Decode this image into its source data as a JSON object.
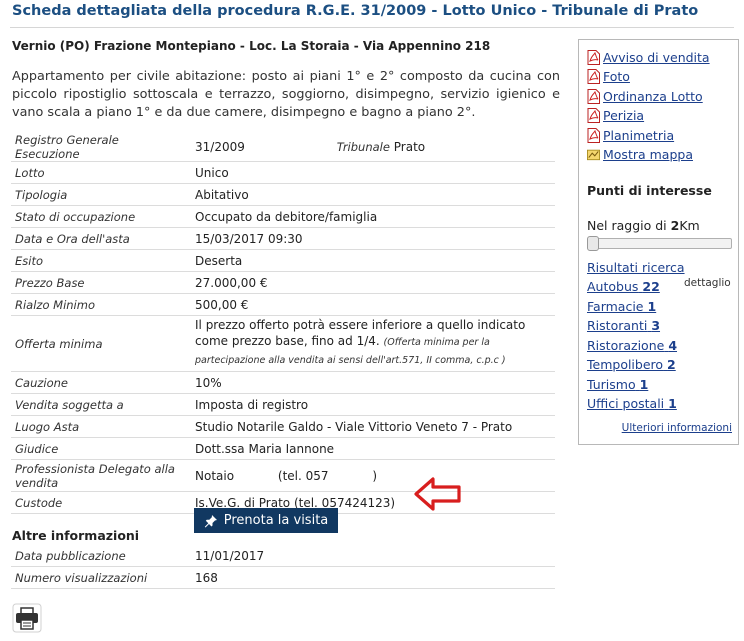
{
  "header": {
    "title": "Scheda dettagliata della procedura R.G.E. 31/2009 - Lotto Unico - Tribunale di Prato",
    "address": "Vernio (PO) Frazione Montepiano - Loc. La Storaia - Via Appennino 218",
    "description": "Appartamento per civile abitazione: posto ai piani 1° e 2° composto da cucina con piccolo ripostiglio sottoscala e terrazzo, soggiorno, disimpegno, servizio igienico e vano scala a piano 1° e da due camere, disimpegno e bagno a piano 2°."
  },
  "details": {
    "registro_label": "Registro Generale Esecuzione",
    "registro_value": "31/2009",
    "tribunale_label": "Tribunale",
    "tribunale_value": "Prato",
    "rows": [
      {
        "label": "Lotto",
        "value": "Unico"
      },
      {
        "label": "Tipologia",
        "value": "Abitativo"
      },
      {
        "label": "Stato di occupazione",
        "value": "Occupato da debitore/famiglia"
      },
      {
        "label": "Data e Ora dell'asta",
        "value": "15/03/2017 09:30"
      },
      {
        "label": "Esito",
        "value": "Deserta"
      },
      {
        "label": "Prezzo Base",
        "value": "27.000,00 €"
      },
      {
        "label": "Rialzo Minimo",
        "value": "500,00 €"
      }
    ],
    "offerta_label": "Offerta minima",
    "offerta_value": "Il prezzo offerto potrà essere inferiore a quello indicato come prezzo base, fino ad 1/4.",
    "offerta_note": "(Offerta minima per la partecipazione alla vendita ai sensi dell'art.571, II comma, c.p.c )",
    "rows2": [
      {
        "label": "Cauzione",
        "value": "10%"
      },
      {
        "label": "Vendita soggetta a",
        "value": "Imposta di registro"
      },
      {
        "label": "Luogo Asta",
        "value": "Studio Notarile Galdo - Viale Vittorio Veneto 7 - Prato"
      },
      {
        "label": "Giudice",
        "value": "Dott.ssa Maria Iannone"
      }
    ],
    "professionista_label": "Professionista Delegato alla vendita",
    "professionista_value": "Notaio",
    "professionista_phone": "(tel. 057",
    "professionista_phone_end": ")",
    "custode_label": "Custode",
    "custode_value": "Is.Ve.G. di Prato (tel. 057424123)",
    "prenota_label": "Prenota la visita"
  },
  "altre": {
    "heading": "Altre informazioni",
    "rows": [
      {
        "label": "Data pubblicazione",
        "value": "11/01/2017"
      },
      {
        "label": "Numero visualizzazioni",
        "value": "168"
      }
    ]
  },
  "sidebar": {
    "docs": [
      {
        "label": "Avviso di vendita",
        "icon": "pdf-icon"
      },
      {
        "label": "Foto",
        "icon": "pdf-icon"
      },
      {
        "label": "Ordinanza Lotto",
        "icon": "pdf-icon"
      },
      {
        "label": "Perizia",
        "icon": "pdf-icon"
      },
      {
        "label": "Planimetria",
        "icon": "pdf-icon"
      }
    ],
    "map_label": "Mostra mappa",
    "poi_heading": "Punti di interesse",
    "raggio_prefix": "Nel raggio di ",
    "raggio_value": "2",
    "raggio_unit": "Km",
    "dettaglio": "dettaglio",
    "risultati": "Risultati ricerca",
    "poi": [
      {
        "name": "Autobus",
        "count": "22"
      },
      {
        "name": "Farmacie",
        "count": "1"
      },
      {
        "name": "Ristoranti",
        "count": "3"
      },
      {
        "name": "Ristorazione",
        "count": "4"
      },
      {
        "name": "Tempolibero",
        "count": "2"
      },
      {
        "name": "Turismo",
        "count": "1"
      },
      {
        "name": "Uffici postali",
        "count": "1"
      }
    ],
    "ulteriori": "Ulteriori informazioni"
  },
  "colors": {
    "title": "#1c4f82",
    "button": "#113861",
    "arrow": "#d81e1e",
    "link": "#1c3f8c"
  }
}
